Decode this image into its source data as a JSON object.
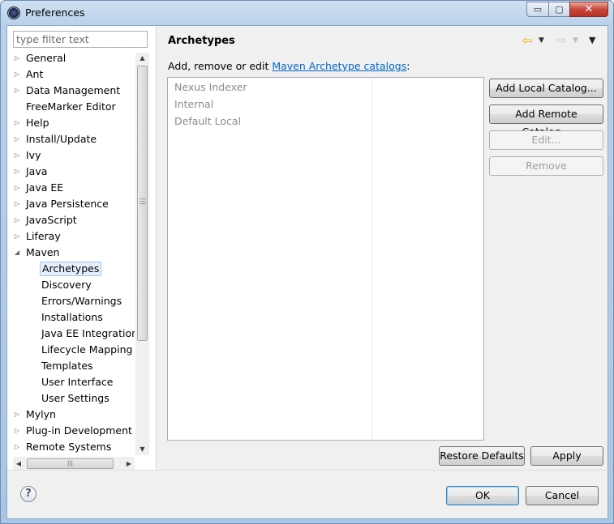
{
  "window": {
    "title": "Preferences"
  },
  "titlebar_buttons": {
    "minimize": "▭",
    "maximize": "▢",
    "close": "✕"
  },
  "filter": {
    "placeholder": "type filter text"
  },
  "tree": {
    "items": [
      {
        "label": "General",
        "expander": "collapsed"
      },
      {
        "label": "Ant",
        "expander": "collapsed"
      },
      {
        "label": "Data Management",
        "expander": "collapsed"
      },
      {
        "label": "FreeMarker Editor",
        "expander": "none"
      },
      {
        "label": "Help",
        "expander": "collapsed"
      },
      {
        "label": "Install/Update",
        "expander": "collapsed"
      },
      {
        "label": "Ivy",
        "expander": "collapsed"
      },
      {
        "label": "Java",
        "expander": "collapsed"
      },
      {
        "label": "Java EE",
        "expander": "collapsed"
      },
      {
        "label": "Java Persistence",
        "expander": "collapsed"
      },
      {
        "label": "JavaScript",
        "expander": "collapsed"
      },
      {
        "label": "Liferay",
        "expander": "collapsed"
      },
      {
        "label": "Maven",
        "expander": "expanded"
      }
    ],
    "maven_children": [
      {
        "label": "Archetypes",
        "selected": true
      },
      {
        "label": "Discovery"
      },
      {
        "label": "Errors/Warnings"
      },
      {
        "label": "Installations"
      },
      {
        "label": "Java EE Integration"
      },
      {
        "label": "Lifecycle Mapping"
      },
      {
        "label": "Templates"
      },
      {
        "label": "User Interface"
      },
      {
        "label": "User Settings"
      }
    ],
    "after_items": [
      {
        "label": "Mylyn",
        "expander": "collapsed"
      },
      {
        "label": "Plug-in Development",
        "expander": "collapsed"
      },
      {
        "label": "Remote Systems",
        "expander": "collapsed"
      }
    ]
  },
  "page": {
    "title": "Archetypes",
    "description_prefix": "Add, remove or edit ",
    "description_link": "Maven Archetype catalogs",
    "description_suffix": ":",
    "catalogs": [
      "Nexus Indexer",
      "Internal",
      "Default Local"
    ]
  },
  "buttons": {
    "add_local": "Add Local Catalog...",
    "add_remote": "Add Remote Catalog...",
    "edit": "Edit...",
    "remove": "Remove",
    "restore_defaults": "Restore Defaults",
    "apply": "Apply",
    "ok": "OK",
    "cancel": "Cancel"
  },
  "icons": {
    "back": "back-arrow-icon",
    "forward": "forward-arrow-icon",
    "menu": "view-menu-icon",
    "help": "help-icon"
  },
  "colors": {
    "link": "#0066cc",
    "title_bar": "#b9d1ea",
    "back_arrow": "#e8b400"
  }
}
